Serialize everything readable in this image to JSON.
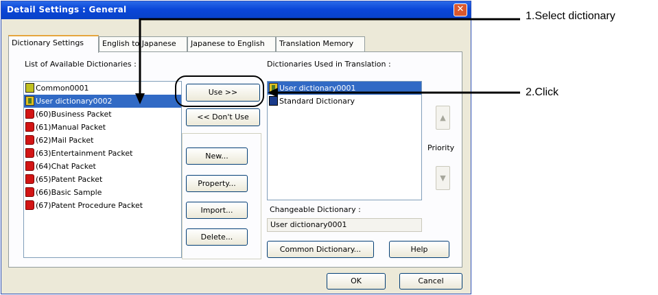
{
  "window": {
    "title": "Detail Settings : General",
    "close_glyph": "✕"
  },
  "tabs": [
    {
      "label": "Dictionary Settings"
    },
    {
      "label": "English to Japanese"
    },
    {
      "label": "Japanese to English"
    },
    {
      "label": "Translation Memory"
    }
  ],
  "available": {
    "label": "List of Available Dictionaries :",
    "items": [
      {
        "label": "Common0001",
        "icon": "common-dictionary-icon"
      },
      {
        "label": "User dictionary0002",
        "icon": "user-dictionary-icon"
      },
      {
        "label": "(60)Business Packet",
        "icon": "packet-dictionary-icon"
      },
      {
        "label": "(61)Manual Packet",
        "icon": "packet-dictionary-icon"
      },
      {
        "label": "(62)Mail Packet",
        "icon": "packet-dictionary-icon"
      },
      {
        "label": "(63)Entertainment Packet",
        "icon": "packet-dictionary-icon"
      },
      {
        "label": "(64)Chat Packet",
        "icon": "packet-dictionary-icon"
      },
      {
        "label": "(65)Patent Packet",
        "icon": "packet-dictionary-icon"
      },
      {
        "label": "(66)Basic Sample",
        "icon": "packet-dictionary-icon"
      },
      {
        "label": "(67)Patent Procedure Packet",
        "icon": "packet-dictionary-icon"
      }
    ]
  },
  "buttons": {
    "use": "Use >>",
    "dont_use": "<< Don't Use",
    "new": "New...",
    "property": "Property...",
    "import": "Import...",
    "delete": "Delete...",
    "common_dictionary": "Common Dictionary...",
    "help": "Help",
    "ok": "OK",
    "cancel": "Cancel"
  },
  "used": {
    "label": "Dictionaries Used in Translation :",
    "items": [
      {
        "label": "User dictionary0001",
        "icon": "user-dictionary-icon"
      },
      {
        "label": "Standard Dictionary",
        "icon": "standard-dictionary-icon"
      }
    ]
  },
  "priority": {
    "label": "Priority",
    "up_glyph": "▲",
    "down_glyph": "▼"
  },
  "changeable": {
    "label": "Changeable Dictionary :",
    "value": "User dictionary0001"
  },
  "callouts": [
    {
      "text": "1.Select dictionary"
    },
    {
      "text": "2.Click"
    }
  ],
  "colors": {
    "selection": "#316ac5",
    "titlebar": "#0a46d8",
    "dialog_bg": "#ece9d8"
  }
}
